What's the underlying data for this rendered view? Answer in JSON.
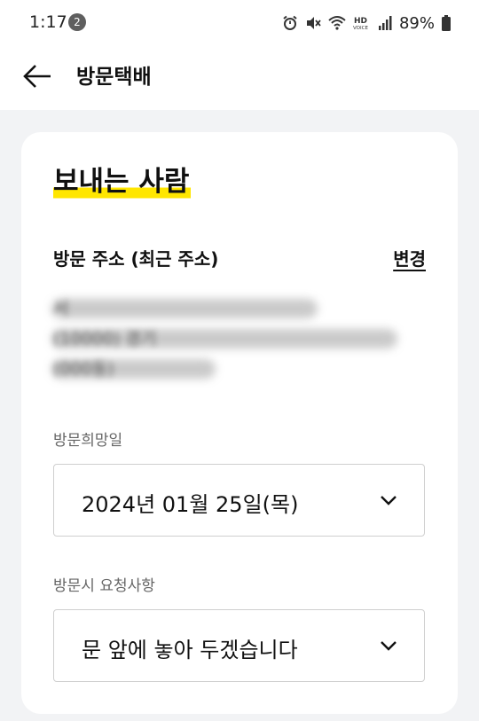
{
  "status_bar": {
    "time": "1:17",
    "notification_count": "2",
    "battery": "89%",
    "icons": [
      "alarm-icon",
      "mute-icon",
      "wifi-icon",
      "hd-voice-icon",
      "signal-icon",
      "battery-icon"
    ]
  },
  "header": {
    "title": "방문택배",
    "back_icon": "back-arrow-icon"
  },
  "sender": {
    "heading": "보내는 사람",
    "highlight_color": "#ffe600",
    "address_label": "방문 주소 (최근 주소)",
    "change_label": "변경",
    "address_lines": [
      "서",
      "(10000) 경기",
      "(000동)"
    ]
  },
  "visit_date": {
    "label": "방문희망일",
    "value": "2024년 01월 25일(목)"
  },
  "visit_request": {
    "label": "방문시 요청사항",
    "value": "문 앞에 놓아 두겠습니다"
  }
}
